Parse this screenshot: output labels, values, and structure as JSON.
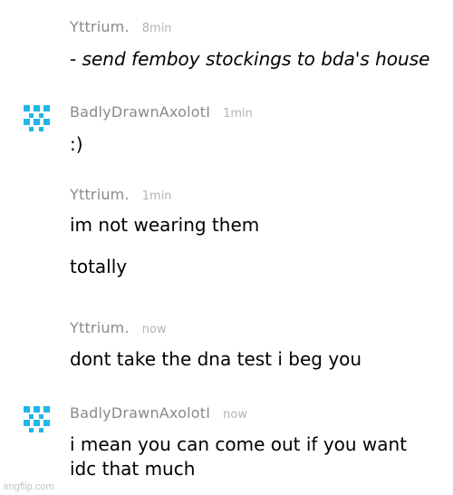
{
  "messages": [
    {
      "author": "Yttrium.",
      "time": "8min",
      "lines": [
        "- send femboy stockings to bda's house"
      ]
    },
    {
      "author": "BadlyDrawnAxolotI",
      "time": "1min",
      "lines": [
        ":)"
      ]
    },
    {
      "author": "Yttrium.",
      "time": "1min",
      "lines": [
        "im not wearing them",
        "totally"
      ]
    },
    {
      "author": "Yttrium.",
      "time": "now",
      "lines": [
        "dont take the dna test i beg you"
      ]
    },
    {
      "author": "BadlyDrawnAxolotI",
      "time": "now",
      "lines": [
        "i mean you can come out if you want",
        "idc that much"
      ]
    }
  ],
  "watermark": "imgflip.com",
  "colors": {
    "avatar": "#1fb6ea",
    "author": "#8a8a8a",
    "time": "#b3b3b3",
    "text": "#000000"
  }
}
